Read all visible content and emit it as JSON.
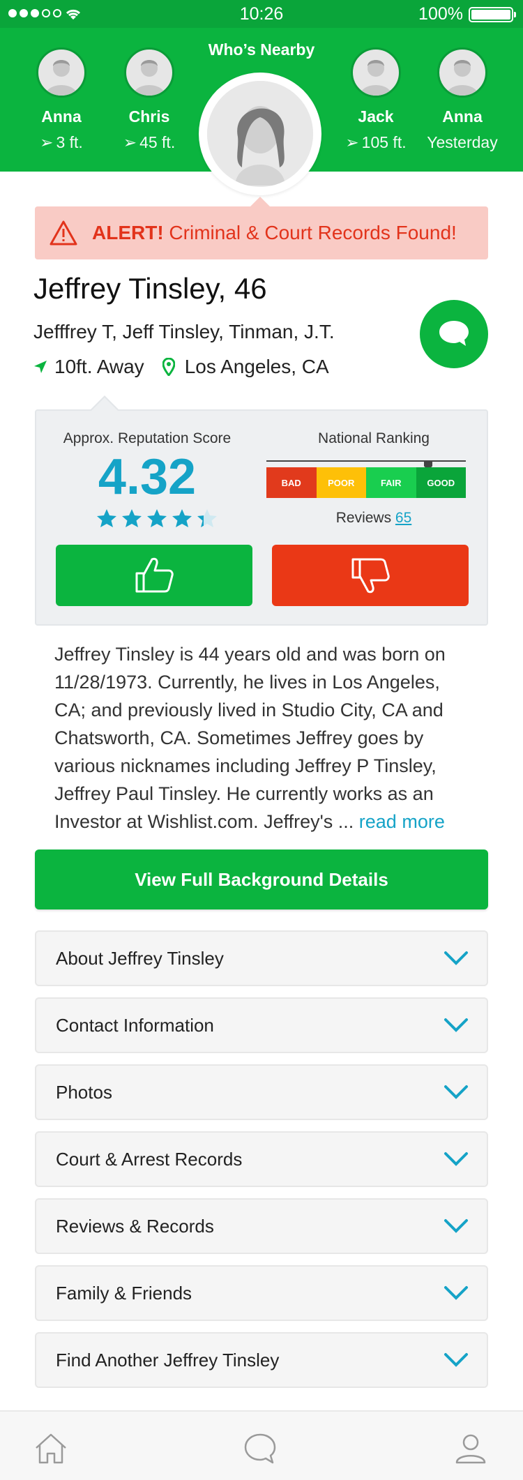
{
  "status": {
    "time": "10:26",
    "battery": "100%"
  },
  "header": {
    "title": "Who’s Nearby",
    "people": [
      {
        "name": "Anna",
        "distance": "3 ft."
      },
      {
        "name": "Chris",
        "distance": "45 ft."
      },
      {
        "name": "Jack",
        "distance": "105 ft."
      },
      {
        "name": "Anna",
        "distance": "Yesterday"
      }
    ]
  },
  "alert": {
    "strong": "ALERT!",
    "text": " Criminal & Court Records Found!"
  },
  "profile": {
    "name": "Jeffrey Tinsley, 46",
    "aliases": "Jefffrey T, Jeff Tinsley, Tinman, J.T.",
    "distance": "10ft. Away",
    "location": "Los Angeles, CA"
  },
  "reputation": {
    "title": "Approx. Reputation Score",
    "score": "4.32",
    "stars": 4.32,
    "ranking_title": "National Ranking",
    "ranking_levels": [
      "BAD",
      "POOR",
      "FAIR",
      "GOOD"
    ],
    "reviews_label": "Reviews",
    "reviews_count": "65"
  },
  "colors": {
    "green": "#0bb43f",
    "red": "#ea3816",
    "blue": "#15a3c7",
    "bad": "#e13a1c",
    "poor": "#fec008",
    "fair": "#19ce4f",
    "good": "#0aa53a"
  },
  "bio": {
    "text": "Jeffrey Tinsley is 44 years old and was born on 11/28/1973. Currently, he lives in Los Angeles, CA; and previously lived in Studio City, CA and Chatsworth, CA. Sometimes Jeffrey goes by various nicknames including Jeffrey P Tinsley, Jeffrey Paul Tinsley. He currently works as an Investor at Wishlist.com. Jeffrey's ... ",
    "more": "read more"
  },
  "cta": "View Full Background Details",
  "sections": [
    "About Jeffrey Tinsley",
    "Contact Information",
    "Photos",
    "Court & Arrest Records",
    "Reviews & Records",
    "Family & Friends",
    "Find Another Jeffrey Tinsley"
  ],
  "icons": {
    "nav": [
      "home-icon",
      "chat-icon",
      "profile-icon"
    ]
  }
}
